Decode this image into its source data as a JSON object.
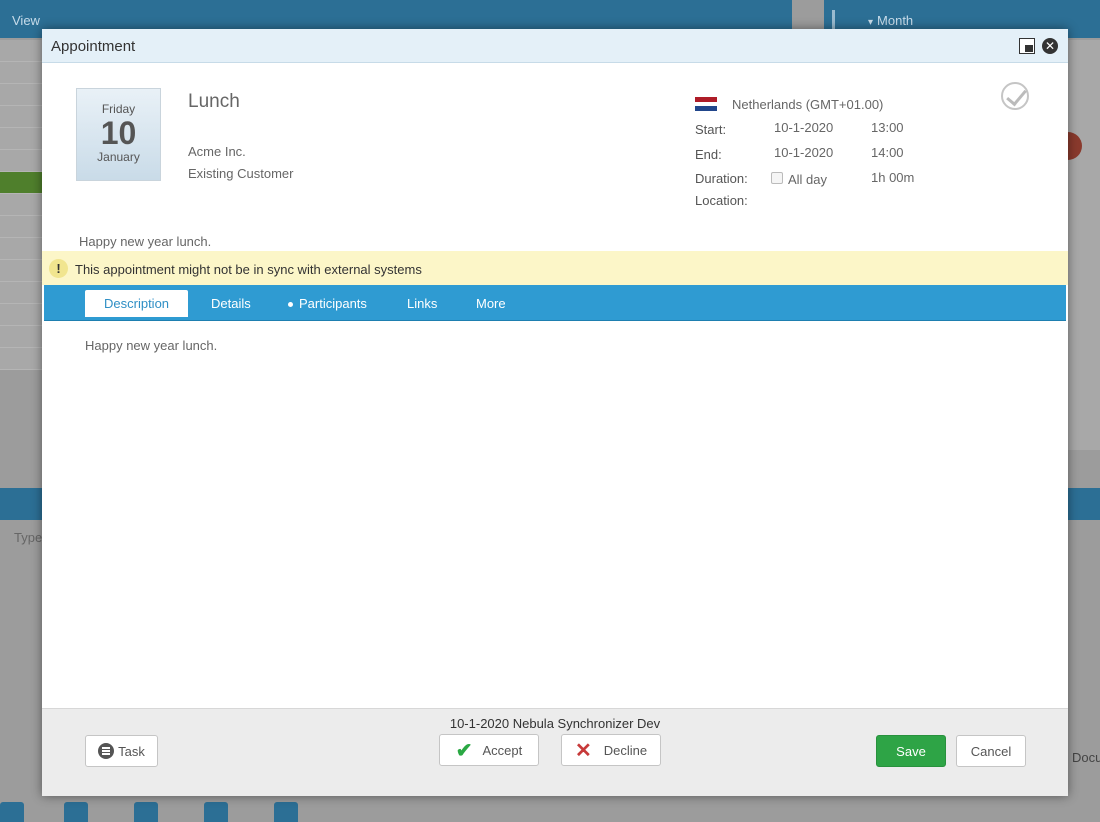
{
  "background": {
    "view_label": "View",
    "month_label": "Month",
    "type_label": "Type",
    "docum_label": "Docum"
  },
  "modal": {
    "title": "Appointment",
    "date": {
      "weekday": "Friday",
      "day": "10",
      "month": "January"
    },
    "subject": "Lunch",
    "company": "Acme Inc.",
    "relation": "Existing Customer",
    "timezone": "Netherlands (GMT+01.00)",
    "start_label": "Start:",
    "start_date": "10-1-2020",
    "start_time": "13:00",
    "end_label": "End:",
    "end_date": "10-1-2020",
    "end_time": "14:00",
    "duration_label": "Duration:",
    "allday_label": "All day",
    "duration_value": "1h 00m",
    "location_label": "Location:",
    "short_description": "Happy new year lunch.",
    "sync_warning": "This appointment might not be in sync with external systems",
    "tabs": [
      {
        "label": "Description"
      },
      {
        "label": "Details"
      },
      {
        "label": "Participants"
      },
      {
        "label": "Links"
      },
      {
        "label": "More"
      }
    ],
    "description_text": "Happy new year lunch.",
    "footer_info": "10-1-2020 Nebula Synchronizer Dev",
    "buttons": {
      "task": "Task",
      "accept": "Accept",
      "decline": "Decline",
      "save": "Save",
      "cancel": "Cancel"
    }
  },
  "colors": {
    "accent": "#2f9bd2",
    "save": "#2ea446",
    "warning_bg": "#fcf6c8"
  }
}
